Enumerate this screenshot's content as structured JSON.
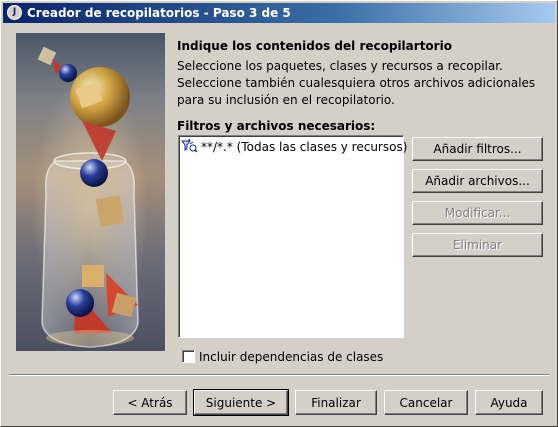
{
  "window": {
    "title": "Creador de recopilatorios - Paso 3 de 5",
    "icon": "java-cup-icon"
  },
  "content": {
    "heading": "Indique los contenidos del recopilartorio",
    "description": "Seleccione los paquetes, clases y recursos a recopilar. Seleccione también cualesquiera otros archivos adicionales para su inclusión en el recopilatorio.",
    "filters_label": "Filtros y archivos necesarios:",
    "filters": [
      {
        "icon": "filter-icon",
        "label": "**/*.* (Todas las clases y recursos)"
      }
    ]
  },
  "side_buttons": {
    "add_filters": "Añadir filtros...",
    "add_files": "Añadir archivos...",
    "modify": "Modificar...",
    "remove": "Eliminar"
  },
  "checkbox": {
    "label": "Incluir dependencias de clases",
    "checked": false
  },
  "footer_buttons": {
    "back": "< Atrás",
    "next": "Siguiente >",
    "finish": "Finalizar",
    "cancel": "Cancelar",
    "help": "Ayuda"
  }
}
